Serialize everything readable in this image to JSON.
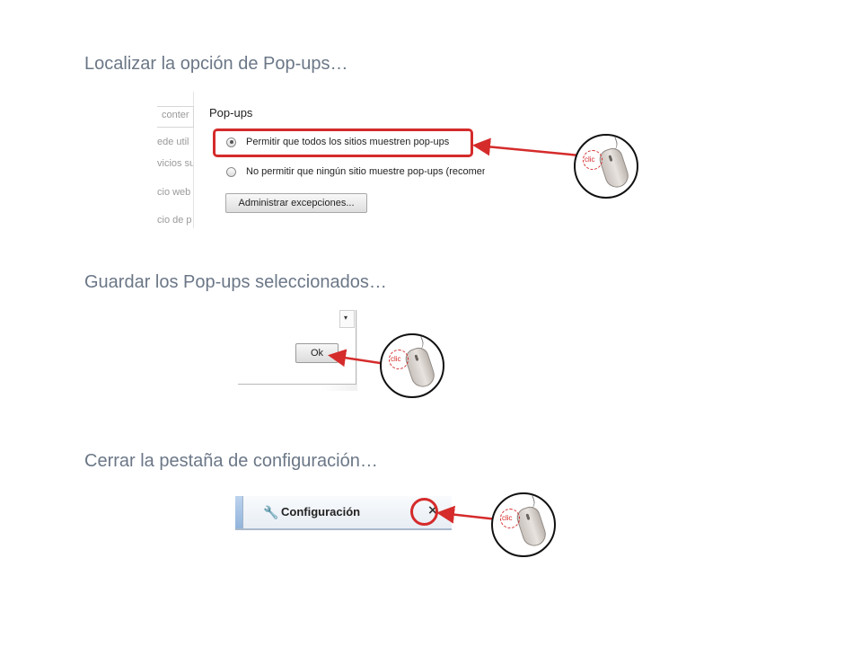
{
  "steps": [
    {
      "heading": "Localizar la opción de Pop-ups…",
      "crop_fragments": {
        "search_placeholder": "conter",
        "left_text": [
          "ede util",
          "vicios su",
          "cio web",
          "cio de p"
        ]
      },
      "section_title": "Pop-ups",
      "options": [
        {
          "label": "Permitir que todos los sitios muestren pop-ups",
          "selected": true
        },
        {
          "label": "No permitir que ningún sitio muestre pop-ups (recomendado)",
          "selected": false
        }
      ],
      "button_label": "Administrar excepciones...",
      "click_label": "clic"
    },
    {
      "heading": "Guardar los Pop-ups seleccionados…",
      "dropdown_arrow": "▾",
      "button_label": "Ok",
      "click_label": "clic"
    },
    {
      "heading": "Cerrar la pestaña de configuración…",
      "tab_title": "Configuración",
      "wrench_icon": "🔧",
      "close_glyph": "×",
      "click_label": "clic"
    }
  ],
  "colors": {
    "highlight": "#d52b2b",
    "heading": "#6b7787"
  }
}
